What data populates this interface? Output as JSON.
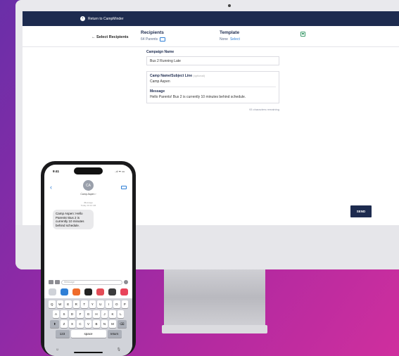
{
  "app": {
    "return_link": "Return to CampMinder",
    "select_recipients": "← Select Recipients",
    "recipients": {
      "title": "Recipients",
      "count": "64 Parents"
    },
    "template": {
      "title": "Template",
      "value": "None",
      "link": "Select"
    },
    "campaign_name": {
      "label": "Campaign Name",
      "value": "Bus 2 Running Late"
    },
    "subject": {
      "label": "Camp Name/Subject Line",
      "optional": "(optional)",
      "value": "Camp Aspen"
    },
    "message": {
      "label": "Message",
      "value": "Hello Parents! Bus 2 is currently 10 minutes behind schedule."
    },
    "chars_remaining": "93 characters remaining",
    "send_label": "SEND"
  },
  "phone": {
    "time": "9:41",
    "status_right": "..ıl ᯤ ▭",
    "avatar_initials": "CA",
    "contact_name": "Camp Aspen ›",
    "meta_line1": "iMessage",
    "meta_line2": "Today 10:12 AM",
    "bubble_text": "Camp Aspen: Hello Parents! Bus 2 is currently 10 minutes behind schedule.",
    "input_placeholder": "iMessage",
    "keyboard": {
      "row1": [
        "Q",
        "W",
        "E",
        "R",
        "T",
        "Y",
        "U",
        "I",
        "O",
        "P"
      ],
      "row2": [
        "A",
        "S",
        "D",
        "F",
        "G",
        "H",
        "J",
        "K",
        "L"
      ],
      "row3": [
        "Z",
        "X",
        "C",
        "V",
        "B",
        "N",
        "M"
      ],
      "shift": "⬆",
      "delete": "⌫",
      "numbers": "123",
      "space": "space",
      "return": "return"
    },
    "emoji_icon": "☺",
    "mic_icon": "🎙"
  },
  "colors": {
    "navy": "#1d2b4f",
    "link_blue": "#2f7fd6",
    "background_purple": "#8e2aa6",
    "background_pink": "#cf2f9e"
  }
}
